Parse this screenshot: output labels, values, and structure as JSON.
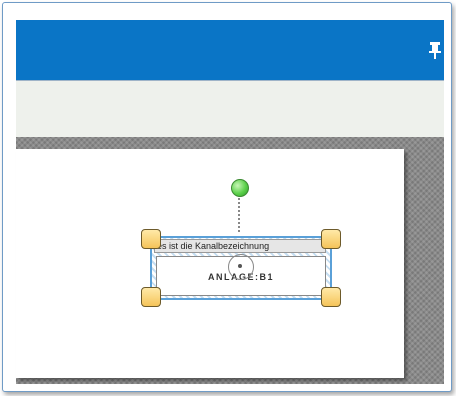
{
  "selected_shape": {
    "label_text": "es ist die Kanalbezeichnung",
    "main_text": "ANLAGE:B1"
  },
  "colors": {
    "title_bar": "#0a75c6",
    "toolbar": "#eef1ec",
    "selection": "#5aa0d8",
    "handle": "#f5c45a",
    "rotate_handle": "#5bd04a"
  },
  "icons": {
    "pin": "pin-icon"
  }
}
